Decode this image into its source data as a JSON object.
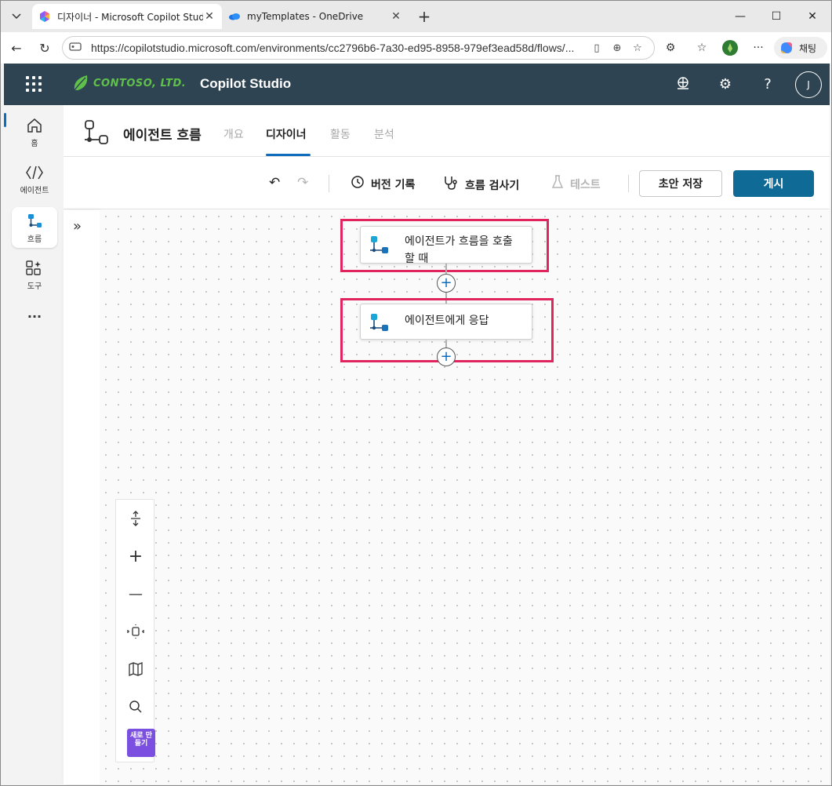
{
  "browser": {
    "tabs": [
      {
        "title": "디자이너 - Microsoft Copilot Studio",
        "active": true
      },
      {
        "title": "myTemplates - OneDrive",
        "active": false
      }
    ],
    "url": "https://copilotstudio.microsoft.com/environments/cc2796b6-7a30-ed95-8958-979ef3ead58d/flows/...",
    "copilot_label": "채팅"
  },
  "app": {
    "brand": "CONTOSO, LTD.",
    "name": "Copilot Studio",
    "avatar_initial": "J"
  },
  "rail": {
    "items": [
      {
        "label": "홈",
        "icon": "home-icon"
      },
      {
        "label": "에이전트",
        "icon": "agent-icon"
      },
      {
        "label": "흐름",
        "icon": "flow-icon"
      },
      {
        "label": "도구",
        "icon": "tools-icon"
      }
    ],
    "more": "···"
  },
  "page": {
    "title": "에이전트 흐름",
    "tabs": [
      "개요",
      "디자이너",
      "활동",
      "분석"
    ],
    "active_tab": "디자이너"
  },
  "commands": {
    "version_history": "버전 기록",
    "flow_checker": "흐름 검사기",
    "test": "테스트",
    "save_draft": "초안 저장",
    "publish": "게시"
  },
  "flow": {
    "nodes": [
      {
        "label": "에이전트가 흐름을 호출할 때"
      },
      {
        "label": "에이전트에게 응답"
      }
    ]
  },
  "zoom_panel": {
    "new_badge": "새로 만들기"
  },
  "colors": {
    "header_bg": "#2f4452",
    "accent": "#0f6cbd",
    "publish_bg": "#0f6b96",
    "highlight": "#e0245e",
    "badge": "#7b4fe0"
  }
}
